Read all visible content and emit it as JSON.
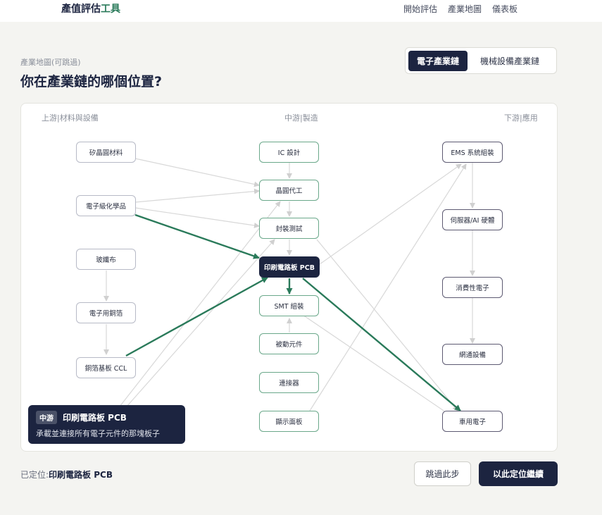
{
  "brand": {
    "main": "產值評估",
    "accent": "工具"
  },
  "nav": [
    "開始評估",
    "產業地圖",
    "儀表板"
  ],
  "eyebrow": "產業地圖(可跳過)",
  "heading": "你在產業鏈的哪個位置?",
  "chain_tabs": [
    {
      "label": "電子產業鏈",
      "active": true
    },
    {
      "label": "機械設備產業鏈",
      "active": false
    }
  ],
  "columns": {
    "upstream": "上游|材料與設備",
    "midstream": "中游|製造",
    "downstream": "下游|應用"
  },
  "nodes": {
    "wafer": "矽晶圓材料",
    "chem": "電子級化學品",
    "glass": "玻纖布",
    "copper": "電子用銅箔",
    "ccl": "銅箔基板 CCL",
    "ic": "IC 設計",
    "foundry": "晶圓代工",
    "pack": "封裝測試",
    "pcb": "印刷電路板 PCB",
    "smt": "SMT 組裝",
    "passive": "被動元件",
    "conn": "連接器",
    "display": "顯示面板",
    "ems": "EMS 系統組裝",
    "server": "伺服器/AI 硬體",
    "consumer": "消費性電子",
    "network": "網通設備",
    "auto": "車用電子"
  },
  "selected": "pcb",
  "tooltip": {
    "stage": "中游",
    "name": "印刷電路板 PCB",
    "desc": "承載並連接所有電子元件的那塊板子"
  },
  "footer": {
    "located_label": "已定位:",
    "located_value": "印刷電路板 PCB",
    "skip": "跳過此步",
    "continue": "以此定位繼續"
  },
  "colors": {
    "navy": "#1c2440",
    "green": "#2a7a5a",
    "edge": "#d8d8d8"
  }
}
